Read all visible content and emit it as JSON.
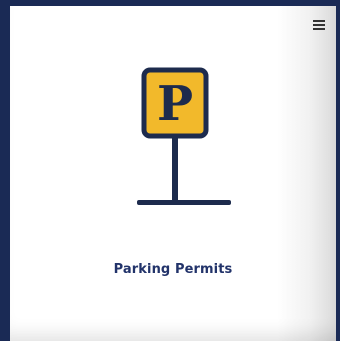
{
  "tile": {
    "title": "Parking Permits",
    "icon": "parking-sign-icon",
    "sign_letter": "P",
    "menu_icon": "hamburger-menu-icon"
  },
  "colors": {
    "frame": "#1a2a55",
    "sign_fill": "#f2b92b",
    "sign_stroke": "#1d2b4d",
    "title_text": "#22336a"
  }
}
